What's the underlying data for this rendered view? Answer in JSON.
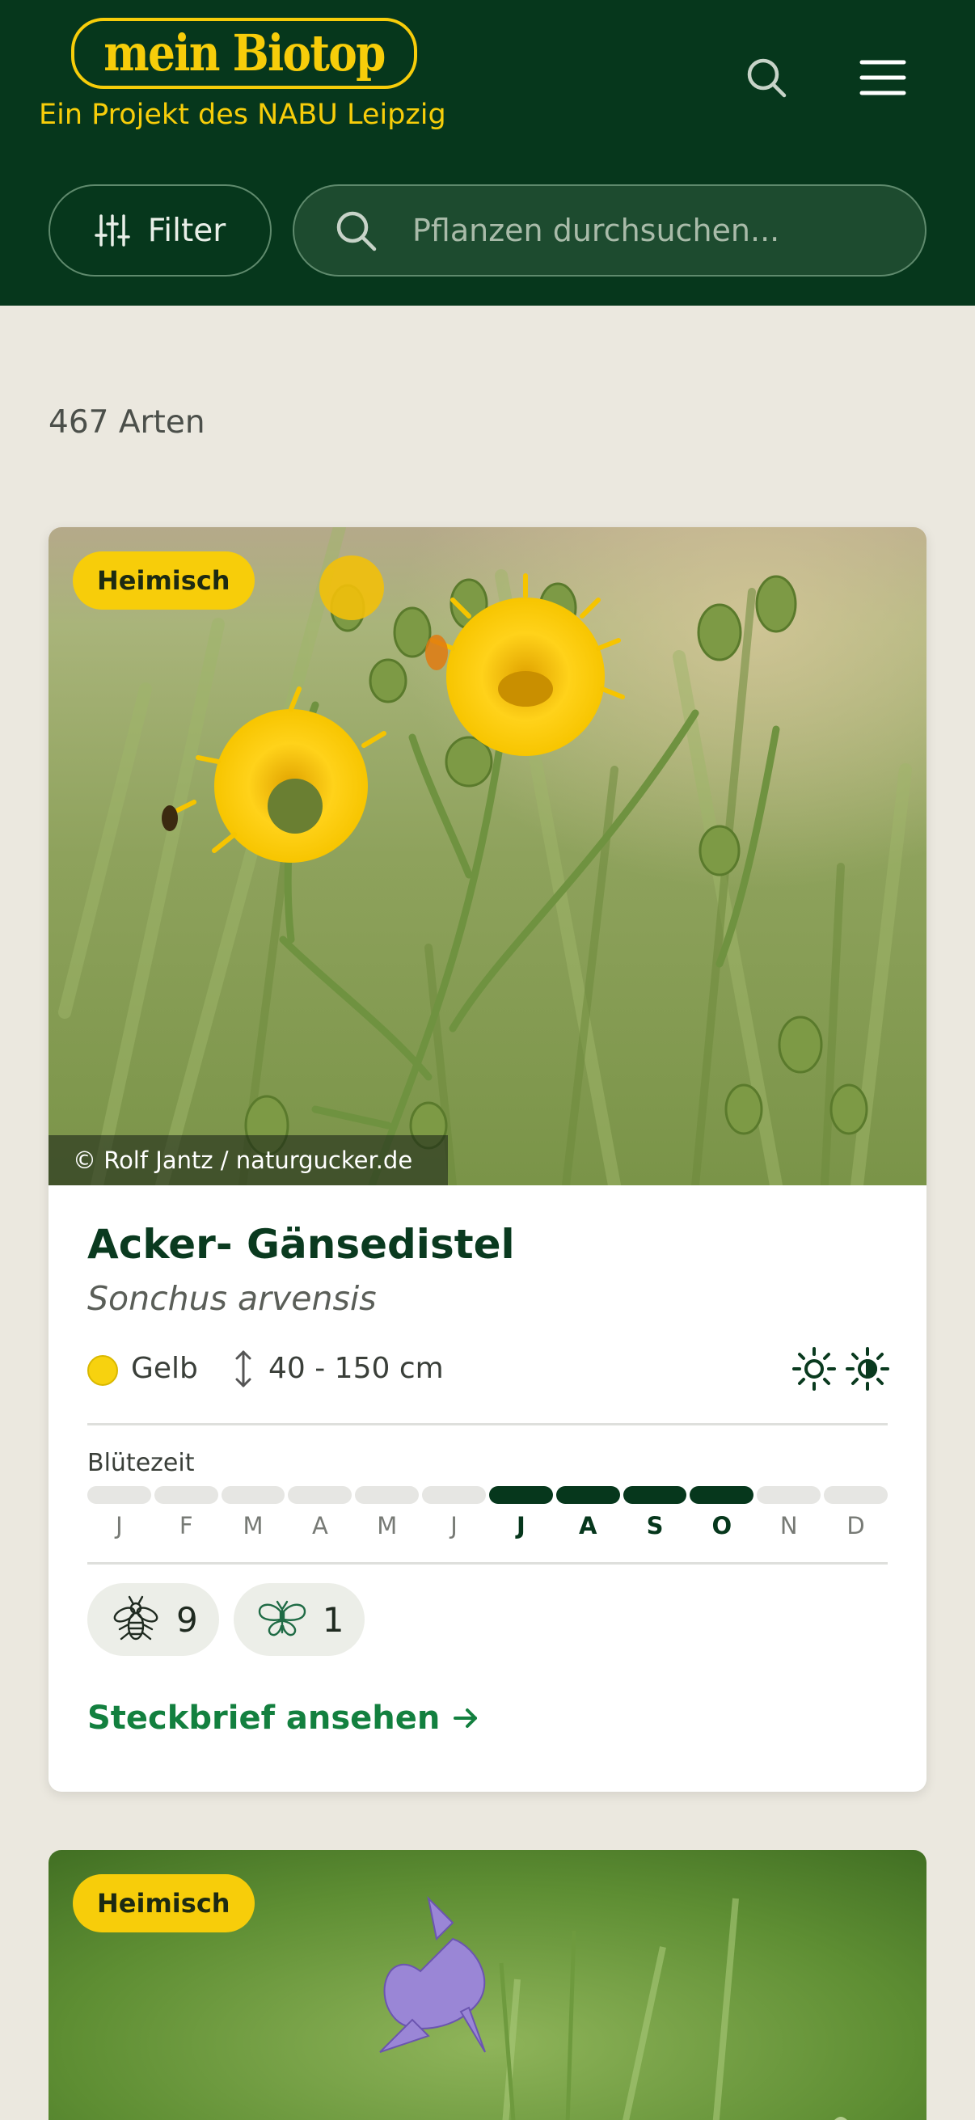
{
  "header": {
    "logo_text": "mein Biotop",
    "tagline": "Ein Projekt des NABU Leipzig",
    "filter_label": "Filter",
    "search_placeholder": "Pflanzen durchsuchen..."
  },
  "count_label": "467 Arten",
  "cards": [
    {
      "badge": "Heimisch",
      "photo_credit": "© Rolf Jantz / naturgucker.de",
      "name": "Acker- Gänsedistel",
      "latin_name": "Sonchus arvensis",
      "flower_color_label": "Gelb",
      "flower_color": "#f7d20f",
      "height": "40 - 150 cm",
      "light_icons": [
        "sun-icon",
        "half-shade-icon"
      ],
      "bloom_label": "Blütezeit",
      "months": [
        "J",
        "F",
        "M",
        "A",
        "M",
        "J",
        "J",
        "A",
        "S",
        "O",
        "N",
        "D"
      ],
      "bloom_active": [
        false,
        false,
        false,
        false,
        false,
        false,
        true,
        true,
        true,
        true,
        false,
        false
      ],
      "pollinators": [
        {
          "icon": "bee-icon",
          "count": "9"
        },
        {
          "icon": "butterfly-icon",
          "count": "1"
        }
      ],
      "cta": "Steckbrief ansehen"
    },
    {
      "badge": "Heimisch"
    }
  ],
  "colors": {
    "header_bg": "#06371c",
    "accent_yellow": "#f7cd0a",
    "page_bg": "#ebe8df",
    "link_green": "#13803f"
  }
}
